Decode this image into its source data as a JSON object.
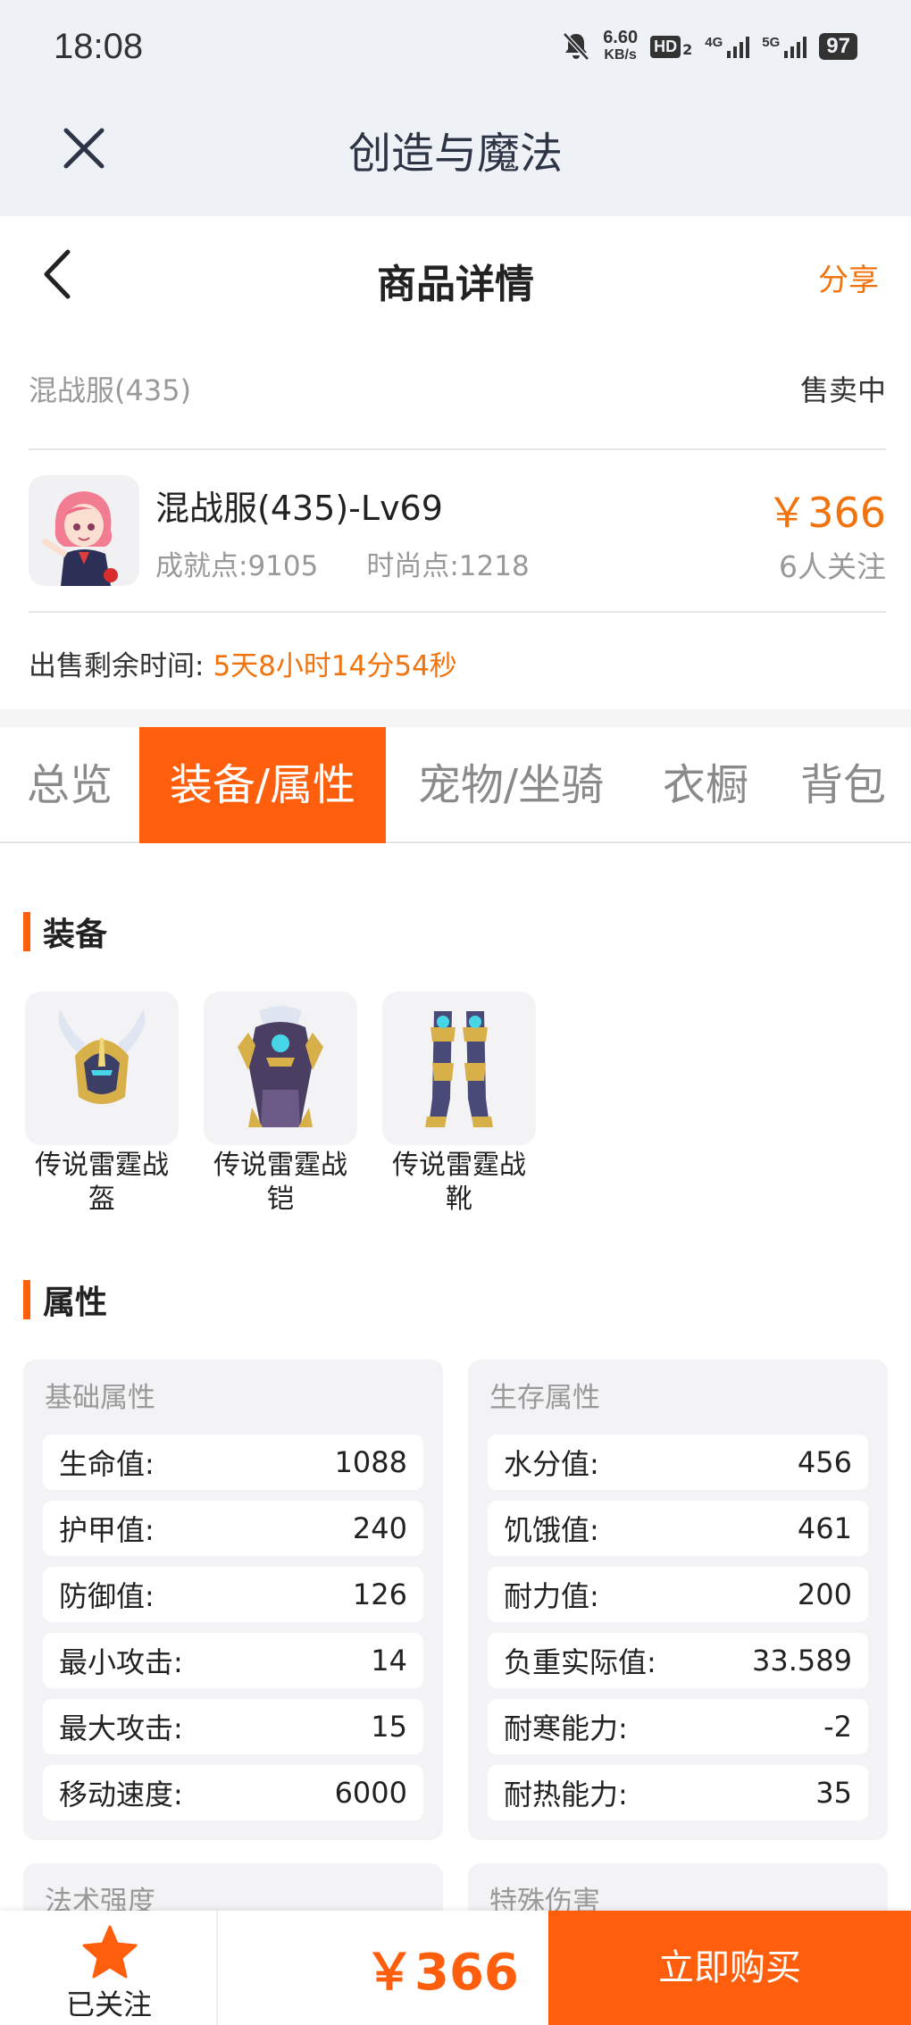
{
  "status_bar": {
    "time": "18:08",
    "net_speed_value": "6.60",
    "net_speed_unit": "KB/s",
    "hd_label": "HD",
    "hd_sub": "2",
    "signal_4g": "4G",
    "signal_5g": "5G",
    "battery": "97"
  },
  "app_bar": {
    "title": "创造与魔法"
  },
  "nav": {
    "title": "商品详情",
    "share_label": "分享"
  },
  "sale": {
    "name": "混战服(435)",
    "status": "售卖中"
  },
  "product": {
    "title": "混战服(435)-Lv69",
    "achievement": "成就点:9105",
    "fashion": "时尚点:1218",
    "price": "￥366",
    "followers": "6人关注"
  },
  "remaining": {
    "label": "出售剩余时间:",
    "value": "5天8小时14分54秒"
  },
  "tabs": [
    {
      "label": "总览",
      "active": false
    },
    {
      "label": "装备/属性",
      "active": true
    },
    {
      "label": "宠物/坐骑",
      "active": false
    },
    {
      "label": "衣橱",
      "active": false
    },
    {
      "label": "背包",
      "active": false
    }
  ],
  "equipment": {
    "title": "装备",
    "items": [
      {
        "name": "传说雷霆战盔",
        "icon": "helmet-icon"
      },
      {
        "name": "传说雷霆战铠",
        "icon": "armor-icon"
      },
      {
        "name": "传说雷霆战靴",
        "icon": "boots-icon"
      }
    ]
  },
  "attributes": {
    "title": "属性",
    "basic": {
      "title": "基础属性",
      "rows": [
        {
          "label": "生命值:",
          "value": "1088"
        },
        {
          "label": "护甲值:",
          "value": "240"
        },
        {
          "label": "防御值:",
          "value": "126"
        },
        {
          "label": "最小攻击:",
          "value": "14"
        },
        {
          "label": "最大攻击:",
          "value": "15"
        },
        {
          "label": "移动速度:",
          "value": "6000"
        }
      ]
    },
    "survival": {
      "title": "生存属性",
      "rows": [
        {
          "label": "水分值:",
          "value": "456"
        },
        {
          "label": "饥饿值:",
          "value": "461"
        },
        {
          "label": "耐力值:",
          "value": "200"
        },
        {
          "label": "负重实际值:",
          "value": "33.589"
        },
        {
          "label": "耐寒能力:",
          "value": "-2"
        },
        {
          "label": "耐热能力:",
          "value": "35"
        }
      ]
    },
    "magic": {
      "title": "法术强度"
    },
    "special": {
      "title": "特殊伤害"
    }
  },
  "bottom_bar": {
    "follow_label": "已关注",
    "price": "￥366",
    "buy_label": "立即购买"
  },
  "colors": {
    "accent": "#ff5f0d",
    "price": "#f0730e",
    "header_bg": "#eef2f6"
  }
}
